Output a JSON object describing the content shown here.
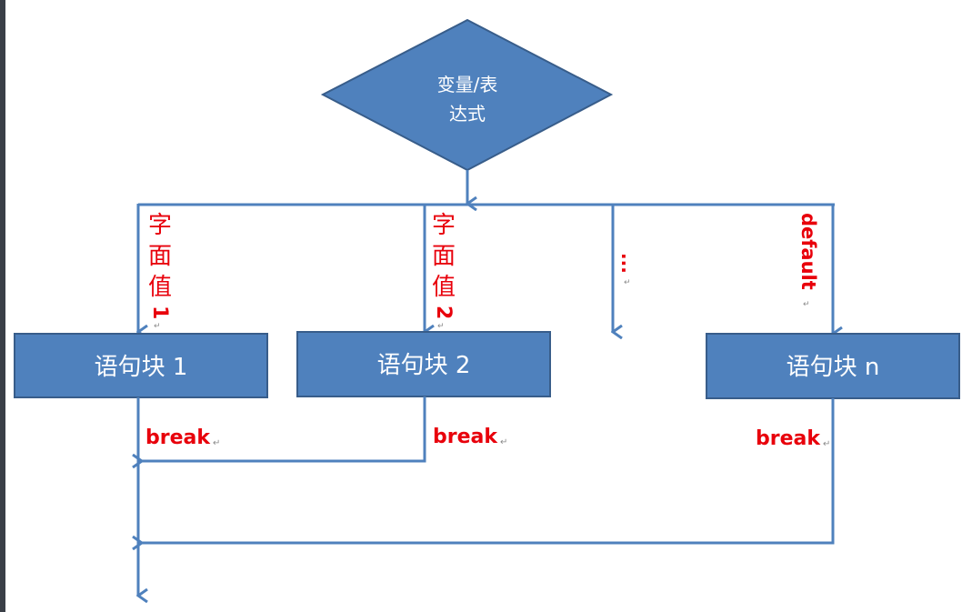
{
  "colors": {
    "shape_fill": "#4f81bd",
    "shape_stroke": "#385d8a",
    "line": "#4f81bd",
    "label": "#e8000b"
  },
  "decision": {
    "line1": "变量/表",
    "line2": "达式"
  },
  "branches": [
    {
      "label_chars": [
        "字",
        "面",
        "值"
      ],
      "label_num": "1",
      "block_label": "语句块 1",
      "break_label": "break"
    },
    {
      "label_chars": [
        "字",
        "面",
        "值"
      ],
      "label_num": "2",
      "block_label": "语句块 2",
      "break_label": "break"
    },
    {
      "ellipsis": "..."
    },
    {
      "default_label": "default",
      "block_label": "语句块 n",
      "break_label": "break"
    }
  ],
  "para_mark": "↵"
}
